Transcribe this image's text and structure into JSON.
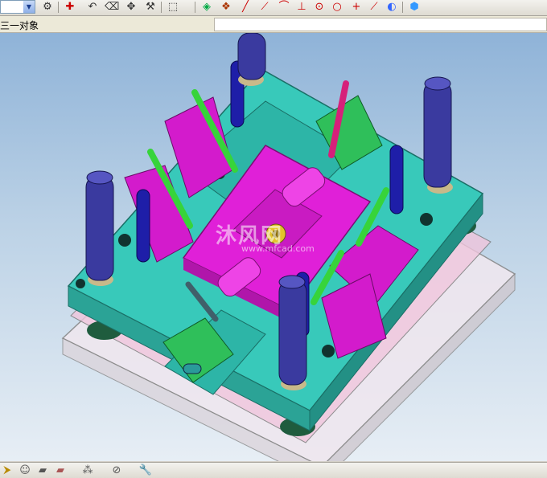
{
  "toolbar": {
    "combo_value": "",
    "icons": [
      "combo-dropdown",
      "settings-icon",
      "add-point-icon",
      "undo-icon",
      "erase-icon",
      "move-icon",
      "tool-icon",
      "select-box-icon",
      "snap-icon",
      "snap-grid-icon",
      "line-icon",
      "tangent-line-icon",
      "arc-icon",
      "perpendicular-icon",
      "circle-center-icon",
      "circle-icon",
      "cross-icon",
      "diagonal-icon",
      "view-icon",
      "cube-icon"
    ]
  },
  "subbar": {
    "label": "三一对象",
    "field_value": ""
  },
  "viewport": {
    "watermark_text": "沐风网",
    "watermark_url": "www.mfcad.com"
  },
  "bottombar": {
    "icons": [
      "select-icon",
      "user-icon",
      "part-icon",
      "layer-icon",
      "assembly-icon",
      "no-icon",
      "wrench-icon"
    ]
  },
  "colors": {
    "plate": "#36c6b8",
    "slider": "#e11fd8",
    "pin_green": "#3fd23a",
    "pin_blue": "#1e1ea8",
    "leader": "#3a3aa0",
    "base": "#e6dbe6"
  }
}
